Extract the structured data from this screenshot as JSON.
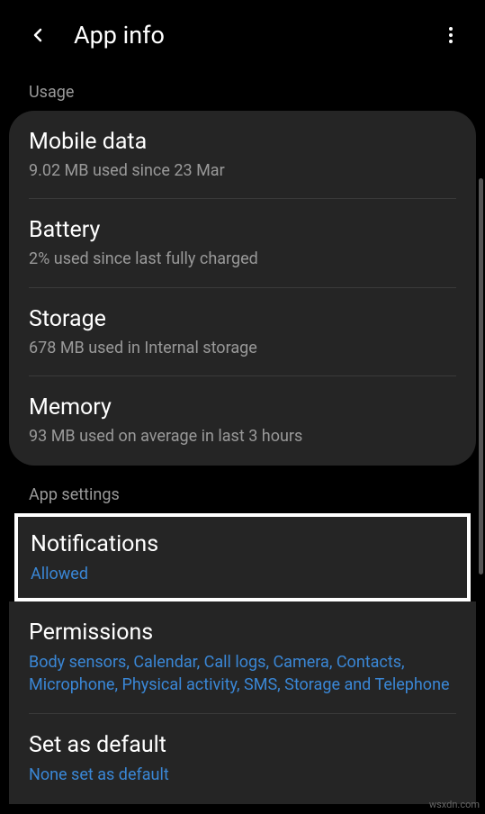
{
  "header": {
    "title": "App info"
  },
  "sections": {
    "usage": {
      "label": "Usage",
      "items": {
        "mobile_data": {
          "title": "Mobile data",
          "subtitle": "9.02 MB used since 23 Mar"
        },
        "battery": {
          "title": "Battery",
          "subtitle": "2% used since last fully charged"
        },
        "storage": {
          "title": "Storage",
          "subtitle": "678 MB used in Internal storage"
        },
        "memory": {
          "title": "Memory",
          "subtitle": "93 MB used on average in last 3 hours"
        }
      }
    },
    "app_settings": {
      "label": "App settings",
      "items": {
        "notifications": {
          "title": "Notifications",
          "subtitle": "Allowed"
        },
        "permissions": {
          "title": "Permissions",
          "subtitle": "Body sensors, Calendar, Call logs, Camera, Contacts, Microphone, Physical activity, SMS, Storage and Telephone"
        },
        "set_as_default": {
          "title": "Set as default",
          "subtitle": "None set as default"
        }
      }
    }
  },
  "watermark": "wsxdn.com"
}
